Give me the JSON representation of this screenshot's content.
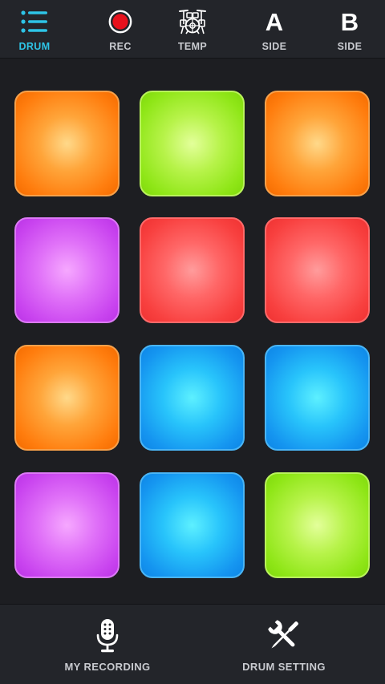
{
  "top_tabs": [
    {
      "label": "DRUM",
      "icon": "list-icon",
      "active": true
    },
    {
      "label": "REC",
      "icon": "record-icon",
      "active": false
    },
    {
      "label": "TEMP",
      "icon": "drum-kit-icon",
      "active": false
    },
    {
      "label": "SIDE",
      "glyph": "A",
      "icon": "letter-a-icon",
      "active": false
    },
    {
      "label": "SIDE",
      "glyph": "B",
      "icon": "letter-b-icon",
      "active": false
    }
  ],
  "pads": [
    {
      "color": "orange"
    },
    {
      "color": "green"
    },
    {
      "color": "orange"
    },
    {
      "color": "purple"
    },
    {
      "color": "red"
    },
    {
      "color": "red"
    },
    {
      "color": "orange"
    },
    {
      "color": "blue"
    },
    {
      "color": "blue"
    },
    {
      "color": "purple"
    },
    {
      "color": "blue"
    },
    {
      "color": "green"
    }
  ],
  "bottom_bar": {
    "recording_label": "MY RECORDING",
    "setting_label": "DRUM SETTING"
  },
  "colors": {
    "accent": "#2ec4e6",
    "background": "#1d1e22",
    "bar": "#23252a",
    "record_red": "#e8111c",
    "label": "#c9cbd0"
  }
}
